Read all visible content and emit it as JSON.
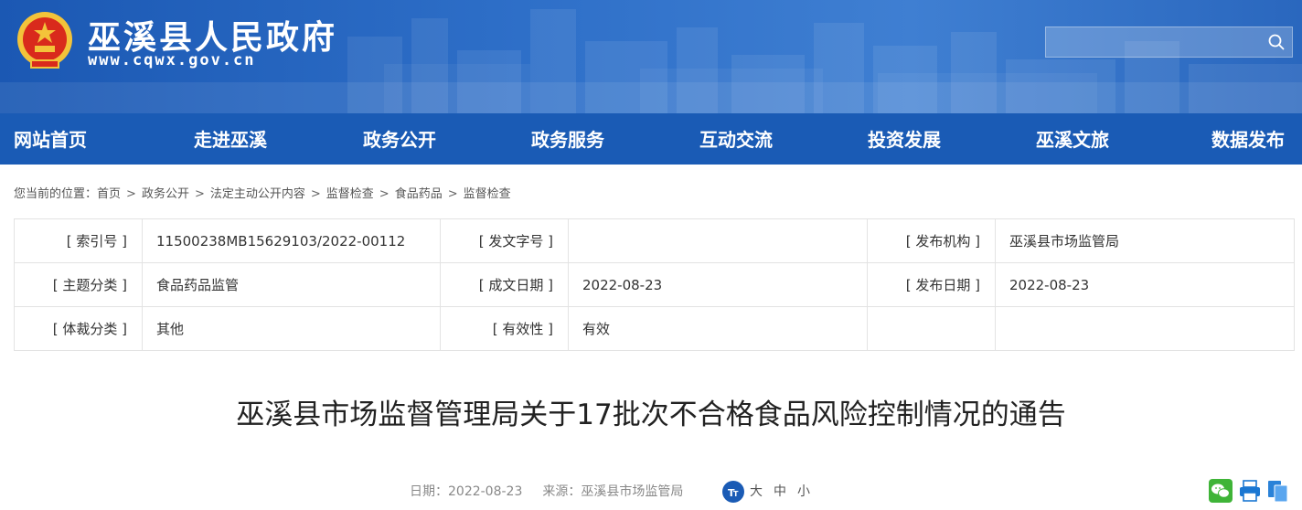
{
  "header": {
    "site_name": "巫溪县人民政府",
    "site_url": "www.cqwx.gov.cn",
    "search_placeholder": "",
    "emblem_icon": "national-emblem-icon",
    "search_icon": "search-icon"
  },
  "nav": {
    "items": [
      "网站首页",
      "走进巫溪",
      "政务公开",
      "政务服务",
      "互动交流",
      "投资发展",
      "巫溪文旅",
      "数据发布"
    ]
  },
  "breadcrumb": {
    "prefix": "您当前的位置：",
    "items": [
      "首页",
      "政务公开",
      "法定主动公开内容",
      "监督检查",
      "食品药品",
      "监督检查"
    ],
    "separator": ">"
  },
  "meta": {
    "index_label": "[ 索引号 ]",
    "index_value": "11500238MB15629103/2022-00112",
    "doc_no_label": "[ 发文字号 ]",
    "doc_no_value": "",
    "issuer_label": "[ 发布机构 ]",
    "issuer_value": "巫溪县市场监管局",
    "topic_label": "[ 主题分类 ]",
    "topic_value": "食品药品监管",
    "written_label": "[ 成文日期 ]",
    "written_value": "2022-08-23",
    "pub_label": "[ 发布日期 ]",
    "pub_value": "2022-08-23",
    "genre_label": "[ 体裁分类 ]",
    "genre_value": "其他",
    "valid_label": "[ 有效性 ]",
    "valid_value": "有效"
  },
  "article": {
    "title": "巫溪县市场监督管理局关于17批次不合格食品风险控制情况的通告",
    "date_text": "日期：2022-08-23",
    "source_text": "来源：巫溪县市场监管局",
    "font_sizes": [
      "大",
      "中",
      "小"
    ],
    "share_icons": [
      "wechat-icon",
      "print-icon",
      "copy-icon"
    ]
  },
  "colors": {
    "header_blue": "#2e6fc8",
    "nav_blue": "#1a5bb5",
    "border": "#e3e3e3"
  }
}
